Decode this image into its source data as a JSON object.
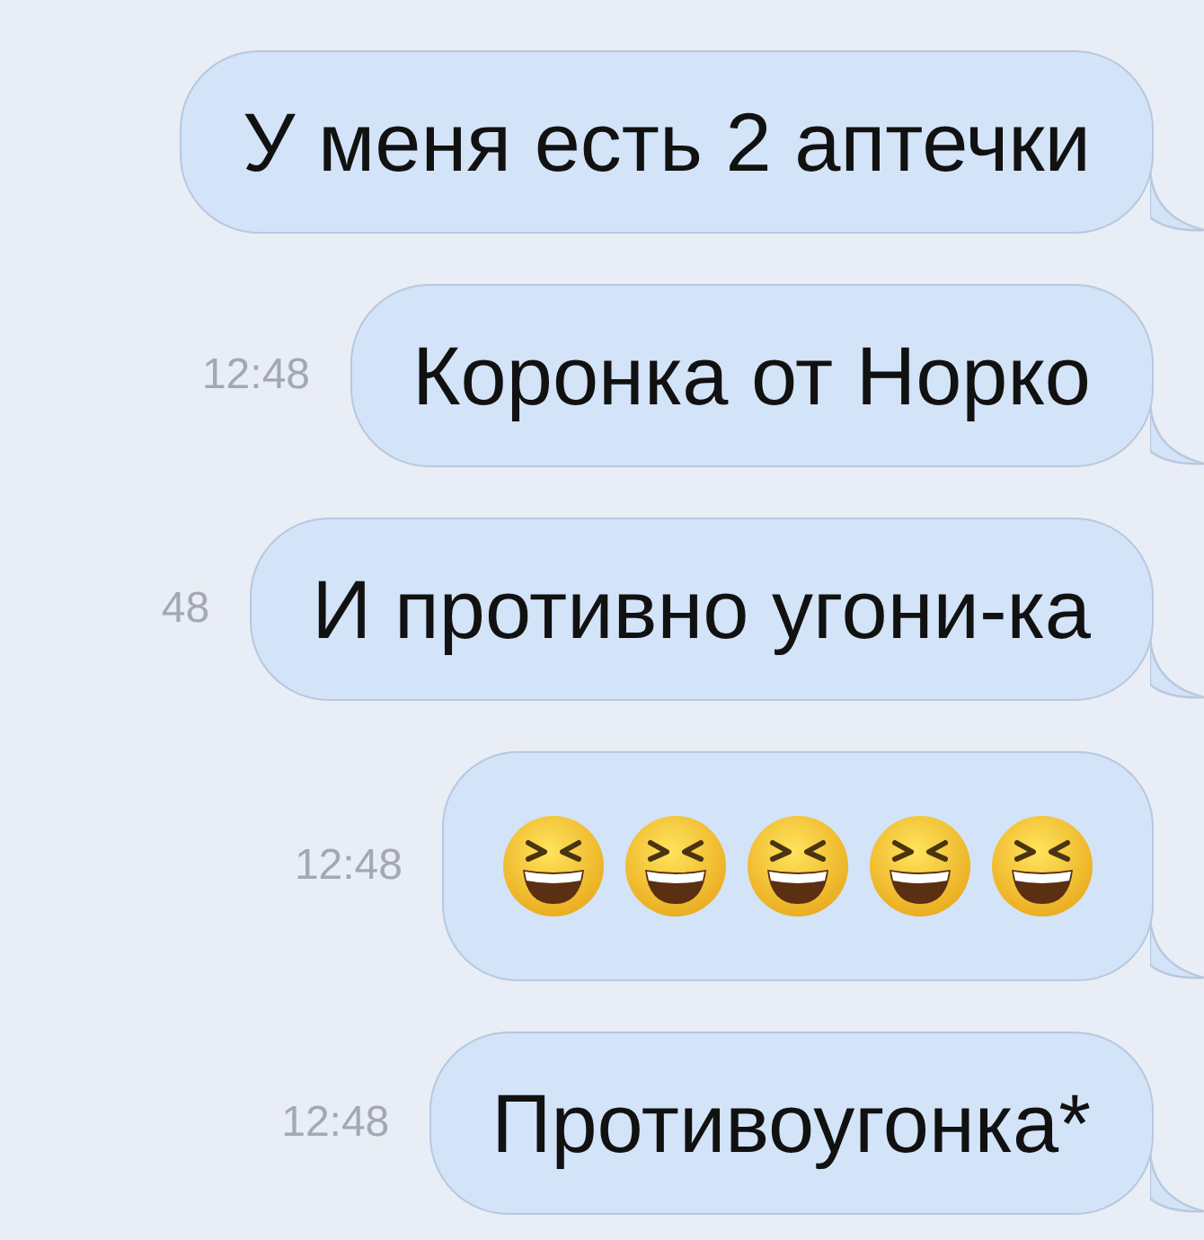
{
  "messages": [
    {
      "kind": "text",
      "text": "У меня есть 2 аптечки"
    },
    {
      "kind": "text",
      "time": "12:48",
      "text": "Коронка от Норко"
    },
    {
      "kind": "text",
      "time": "48",
      "text": "И противно угони-ка"
    },
    {
      "kind": "emoji",
      "time": "12:48",
      "emojis": [
        {
          "kind": "laughing"
        },
        {
          "kind": "laughing"
        },
        {
          "kind": "laughing"
        },
        {
          "kind": "laughing"
        },
        {
          "kind": "laughing"
        }
      ]
    },
    {
      "kind": "text",
      "time": "12:48",
      "text": "Противоугонка*"
    }
  ]
}
